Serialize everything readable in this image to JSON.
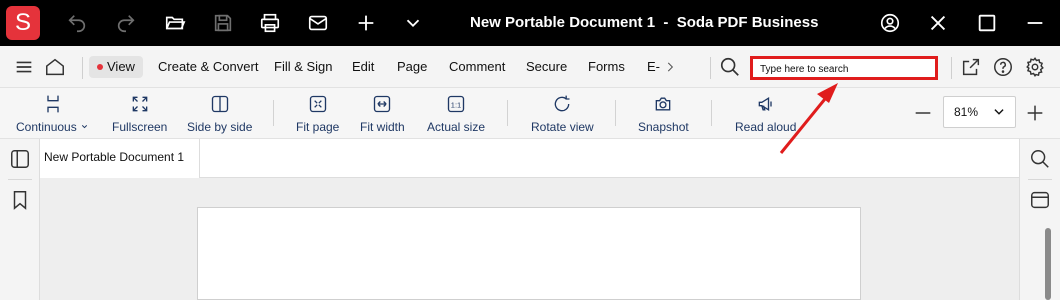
{
  "app": {
    "logo_letter": "S",
    "title": "New Portable Document 1  -  Soda PDF Business",
    "accent": "#e5333b"
  },
  "titlebar_icons": [
    "undo-icon",
    "redo-icon",
    "open-folder-icon",
    "save-icon",
    "print-icon",
    "mail-icon",
    "add-icon",
    "chevron-down-icon",
    "account-icon",
    "minimize-icon",
    "maximize-icon",
    "close-icon"
  ],
  "menu": {
    "items": [
      "View",
      "Create & Convert",
      "Fill & Sign",
      "Edit",
      "Page",
      "Comment",
      "Secure",
      "Forms",
      "E-"
    ],
    "active": "View"
  },
  "search": {
    "placeholder": "Type here to search",
    "highlight_color": "#e01c1c"
  },
  "toolbar": {
    "items": [
      "Continuous",
      "Fullscreen",
      "Side by side",
      "Fit page",
      "Fit width",
      "Actual size",
      "Rotate view",
      "Snapshot",
      "Read aloud"
    ],
    "actual_size_icon_text": "1:1",
    "zoom": "81%"
  },
  "document": {
    "tab_label": "New Portable Document 1"
  }
}
